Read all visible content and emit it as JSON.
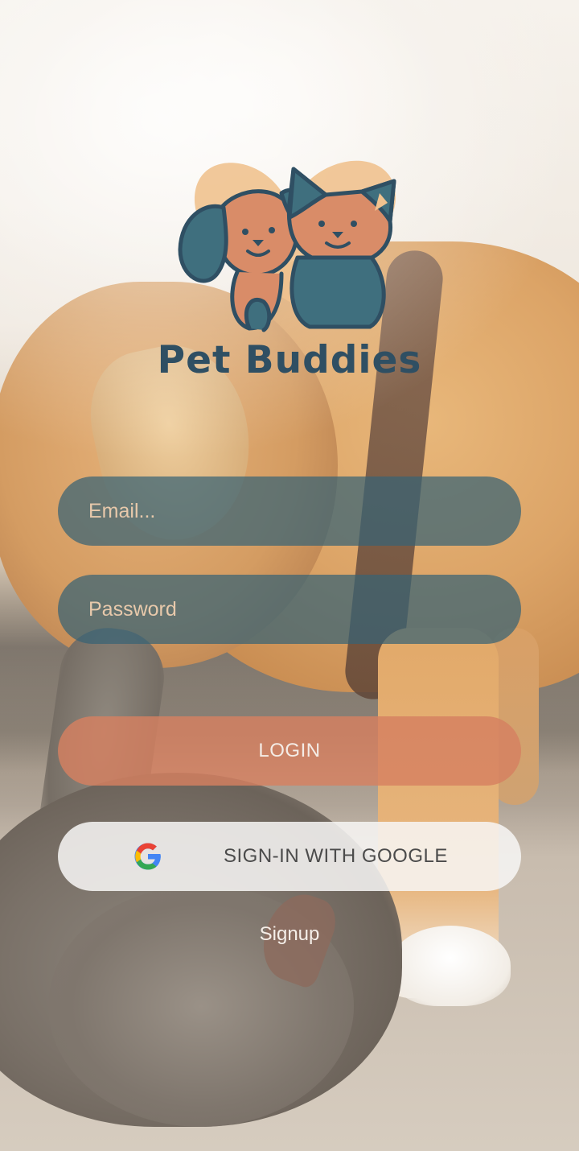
{
  "app": {
    "brand_name": "Pet Buddies",
    "logo_icon": "dog-and-cat-heart-logo"
  },
  "login_form": {
    "email": {
      "value": "",
      "placeholder": "Email..."
    },
    "password": {
      "value": "",
      "placeholder": "Password"
    },
    "login_label": "LOGIN",
    "google_label": "SIGN-IN WITH GOOGLE",
    "google_icon": "google-g-icon",
    "signup_label": "Signup"
  },
  "colors": {
    "field_bg": "#376375",
    "login_bg": "#d68060",
    "google_bg": "#f7f6f4",
    "brand_text": "#2f4f63",
    "heart": "#f0c28f"
  }
}
